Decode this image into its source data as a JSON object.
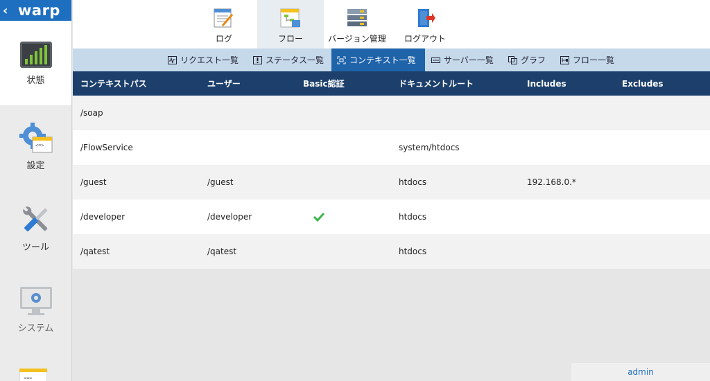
{
  "brand": {
    "name": "warp"
  },
  "sidebar": {
    "items": [
      {
        "label": "状態"
      },
      {
        "label": "設定"
      },
      {
        "label": "ツール"
      },
      {
        "label": "システム"
      }
    ]
  },
  "topnav": {
    "items": [
      {
        "label": "ログ"
      },
      {
        "label": "フロー"
      },
      {
        "label": "バージョン管理"
      },
      {
        "label": "ログアウト"
      }
    ]
  },
  "subnav": {
    "items": [
      {
        "label": "リクエスト一覧"
      },
      {
        "label": "ステータス一覧"
      },
      {
        "label": "コンテキスト一覧"
      },
      {
        "label": "サーバー一覧"
      },
      {
        "label": "グラフ"
      },
      {
        "label": "フロー一覧"
      }
    ]
  },
  "table": {
    "columns": [
      "コンテキストパス",
      "ユーザー",
      "Basic認証",
      "ドキュメントルート",
      "Includes",
      "Excludes"
    ],
    "rows": [
      {
        "path": "/soap",
        "user": "",
        "basic": false,
        "docroot": "",
        "includes": "",
        "excludes": ""
      },
      {
        "path": "/FlowService",
        "user": "",
        "basic": false,
        "docroot": "system/htdocs",
        "includes": "",
        "excludes": ""
      },
      {
        "path": "/guest",
        "user": "/guest",
        "basic": false,
        "docroot": "htdocs",
        "includes": "192.168.0.*",
        "excludes": ""
      },
      {
        "path": "/developer",
        "user": "/developer",
        "basic": true,
        "docroot": "htdocs",
        "includes": "",
        "excludes": ""
      },
      {
        "path": "/qatest",
        "user": "/qatest",
        "basic": false,
        "docroot": "htdocs",
        "includes": "",
        "excludes": ""
      }
    ]
  },
  "user": {
    "name": "admin"
  },
  "colors": {
    "brand": "#1e6fc0",
    "header": "#1c3f6b",
    "subnav": "#c5d9ea",
    "subnav_active": "#1f63a9",
    "check": "#3cb54a"
  }
}
